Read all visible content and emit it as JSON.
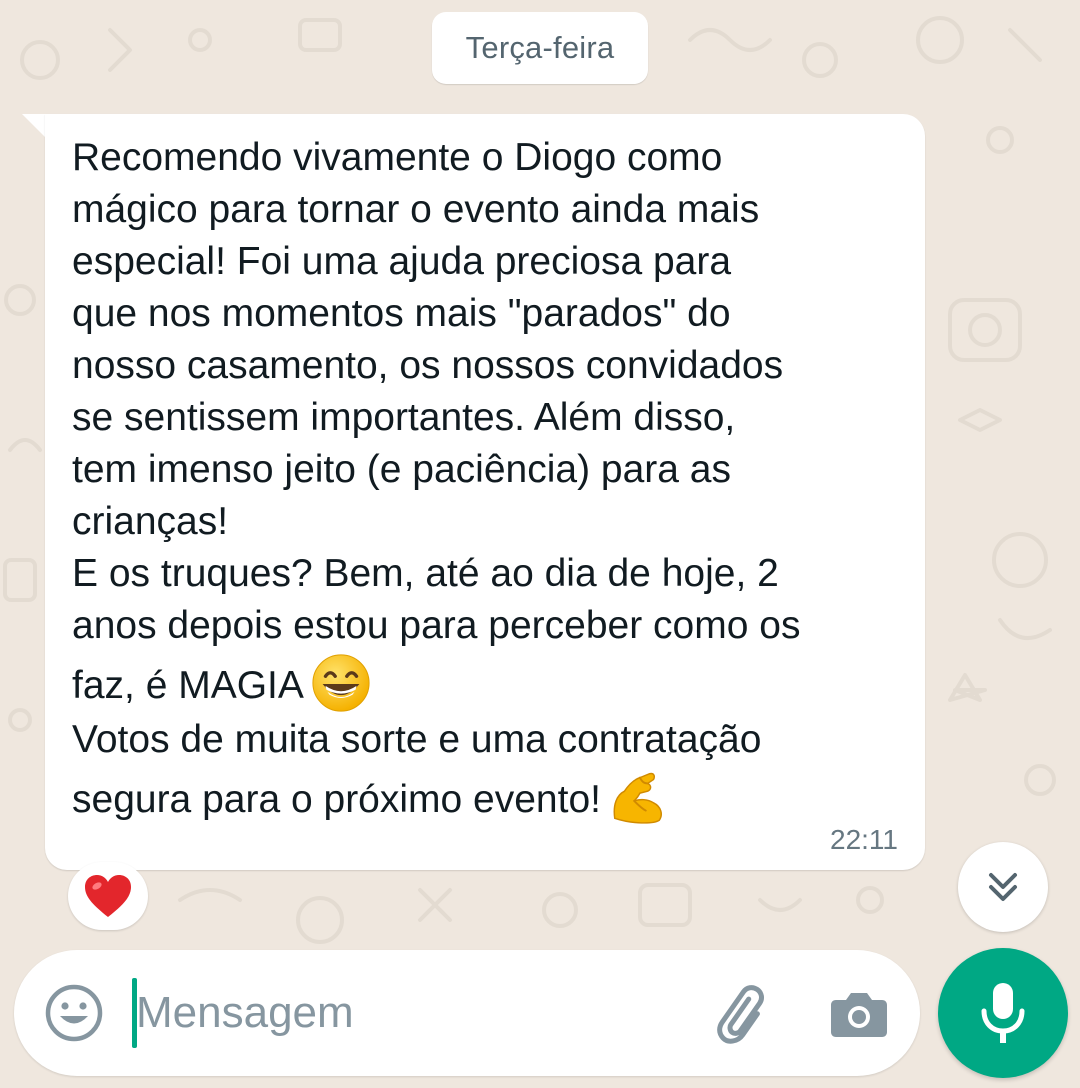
{
  "colors": {
    "background": "#efe7de",
    "bubble": "#ffffff",
    "text": "#111b21",
    "muted": "#667781",
    "accent": "#00a884",
    "icon": "#8696a0"
  },
  "date_divider": {
    "label": "Terça-feira"
  },
  "message": {
    "paragraph_1": "Recomendo vivamente o Diogo como\nmágico para tornar o evento ainda mais\nespecial! Foi uma ajuda preciosa para\nque nos momentos mais \"parados\" do\nnosso casamento, os nossos convidados\nse sentissem importantes. Além disso,\ntem imenso jeito (e paciência) para as\ncrianças!\nE os truques? Bem, até ao dia de hoje, 2\nanos depois estou para perceber como os\nfaz, é MAGIA",
    "emoji_1": "grinning-face-with-smiling-eyes",
    "paragraph_2": "Votos de muita sorte e uma contratação\nsegura para o próximo evento!",
    "emoji_2": "flexed-biceps",
    "time": "22:11",
    "reaction": "red-heart"
  },
  "composer": {
    "placeholder": "Mensagem",
    "value": "",
    "emoji_icon": "smiley-icon",
    "attach_icon": "paperclip-icon",
    "camera_icon": "camera-icon",
    "mic_icon": "microphone-icon"
  },
  "scroll_button_icon": "double-chevron-down-icon"
}
